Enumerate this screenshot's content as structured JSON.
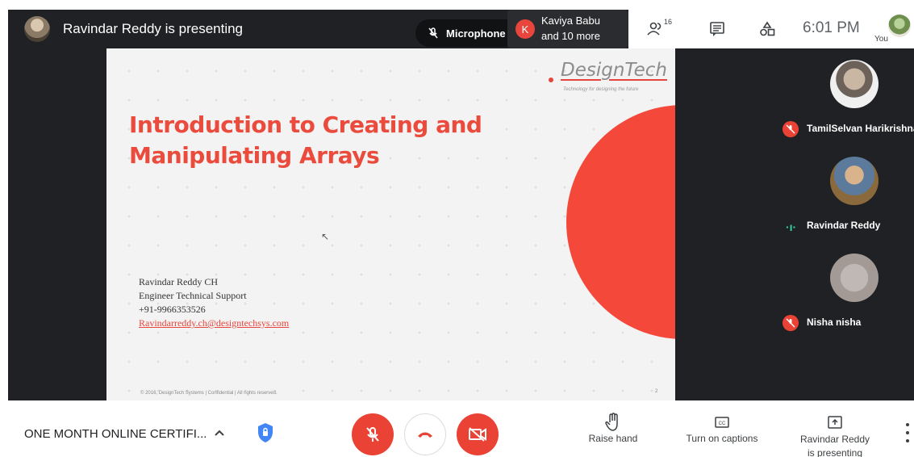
{
  "topbar": {
    "presenting_title": "Ravindar Reddy is presenting",
    "mic_notice": "Microphone o",
    "notification": {
      "avatar_letter": "K",
      "name": "Kaviya Babu",
      "more": "and 10 more"
    },
    "people_count": "16",
    "clock": "6:01 PM",
    "you_label": "You"
  },
  "slide": {
    "logo": "DesignTech",
    "tagline": "Technology for designing the future",
    "title": "Introduction to Creating and Manipulating Arrays",
    "contact": {
      "name": "Ravindar Reddy CH",
      "role": "Engineer Technical Support",
      "phone": "+91-9966353526",
      "email": "Ravindarreddy.ch@designtechsys.com"
    },
    "footer": "© 2016, DesignTech Systems | Confidential | All rights reserved.",
    "page": "2"
  },
  "participants": [
    {
      "name": "TamilSelvan Harikrishna",
      "status": "muted"
    },
    {
      "name": "Ravindar Reddy",
      "status": "speaking"
    },
    {
      "name": "Nisha nisha",
      "status": "muted"
    }
  ],
  "bottombar": {
    "meeting_title": "ONE MONTH ONLINE CERTIFI...",
    "raise_hand": "Raise hand",
    "captions": "Turn on captions",
    "present_line1": "Ravindar Reddy",
    "present_line2": "is presenting"
  },
  "colors": {
    "danger": "#ea4335",
    "slide_accent": "#f4483a",
    "dark": "#202124"
  }
}
